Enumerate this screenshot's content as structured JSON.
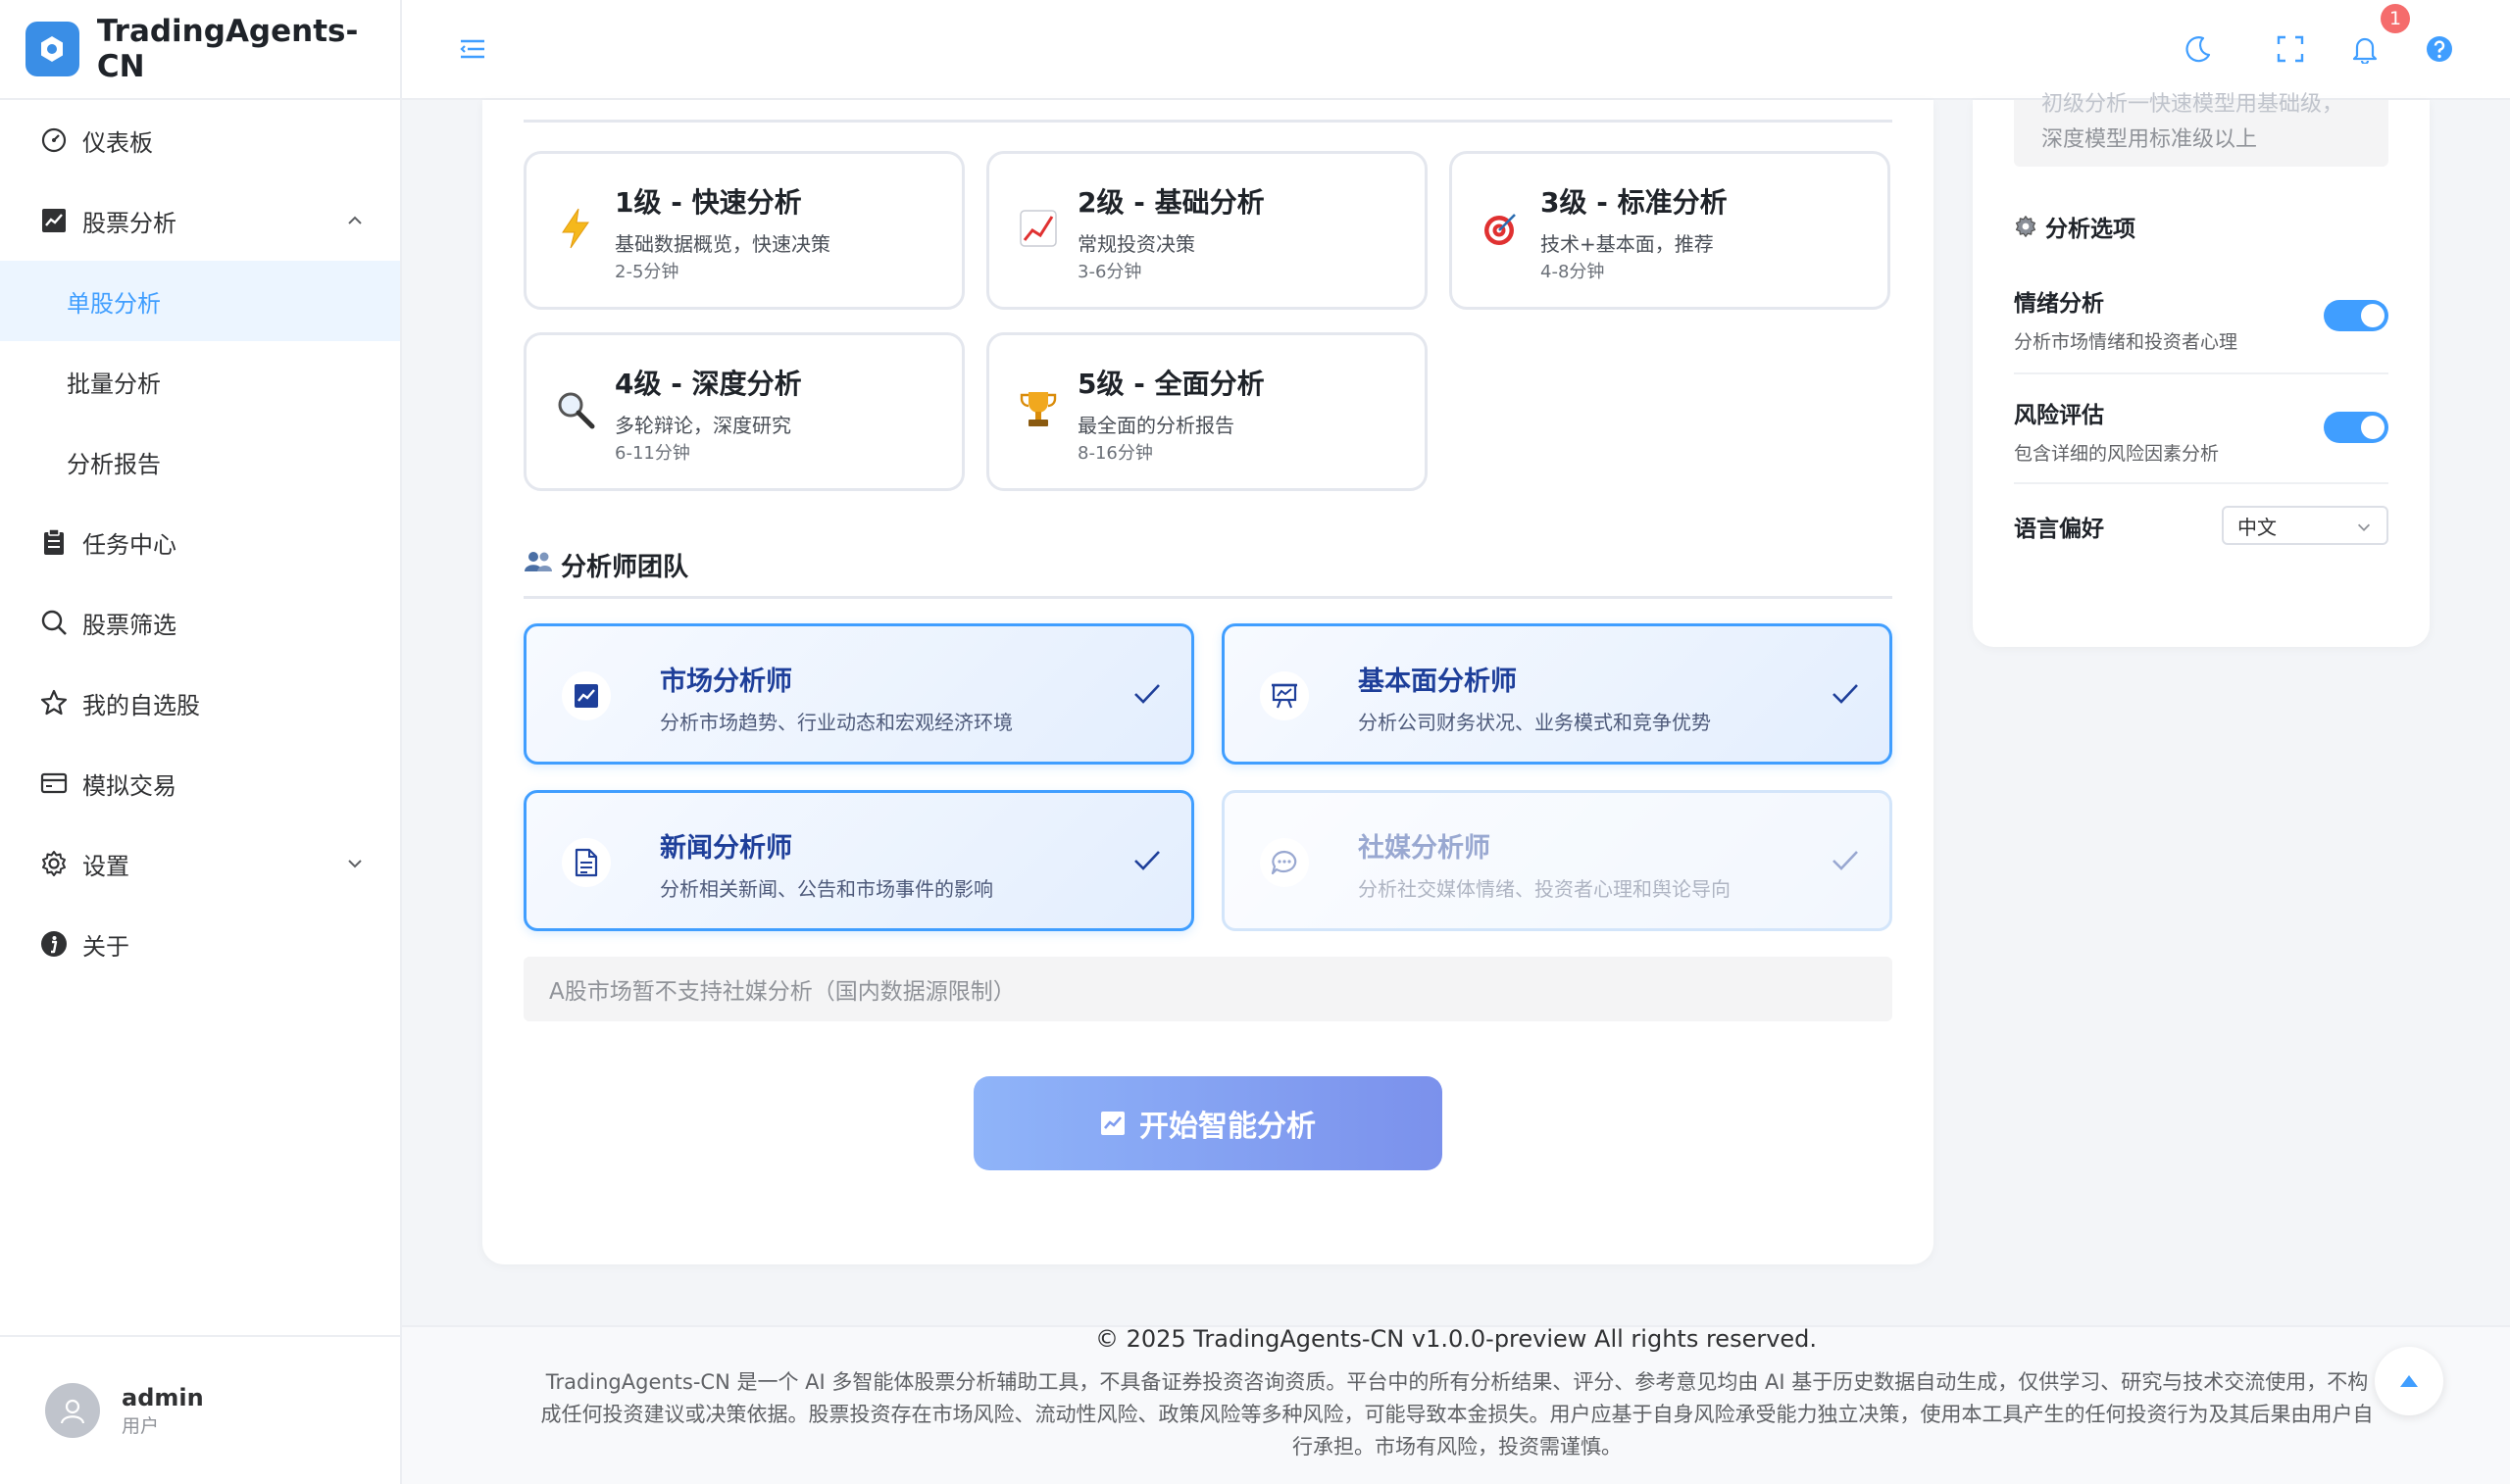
{
  "app": {
    "title": "TradingAgents-CN"
  },
  "sidebar": {
    "items": [
      {
        "label": "仪表板",
        "icon": "gauge-icon"
      },
      {
        "label": "股票分析",
        "icon": "chart-icon",
        "expanded": true,
        "children": [
          {
            "label": "单股分析",
            "active": true
          },
          {
            "label": "批量分析"
          },
          {
            "label": "分析报告"
          }
        ]
      },
      {
        "label": "任务中心",
        "icon": "clipboard-icon"
      },
      {
        "label": "股票筛选",
        "icon": "search-icon"
      },
      {
        "label": "我的自选股",
        "icon": "star-icon"
      },
      {
        "label": "模拟交易",
        "icon": "card-icon"
      },
      {
        "label": "设置",
        "icon": "gear-icon",
        "expanded": false
      },
      {
        "label": "关于",
        "icon": "info-icon"
      }
    ],
    "sub": [
      "单股分析",
      "批量分析",
      "分析报告"
    ]
  },
  "user": {
    "name": "admin",
    "role": "用户"
  },
  "header": {
    "notification_count": "1"
  },
  "levels": [
    {
      "title": "1级 - 快速分析",
      "desc": "基础数据概览，快速决策",
      "time": "2-5分钟",
      "icon": "⚡"
    },
    {
      "title": "2级 - 基础分析",
      "desc": "常规投资决策",
      "time": "3-6分钟",
      "icon": "📈"
    },
    {
      "title": "3级 - 标准分析",
      "desc": "技术+基本面，推荐",
      "time": "4-8分钟",
      "icon": "🎯"
    },
    {
      "title": "4级 - 深度分析",
      "desc": "多轮辩论，深度研究",
      "time": "6-11分钟",
      "icon": "🔍"
    },
    {
      "title": "5级 - 全面分析",
      "desc": "最全面的分析报告",
      "time": "8-16分钟",
      "icon": "🏆"
    }
  ],
  "team": {
    "title": "分析师团队",
    "analysts": [
      {
        "name": "市场分析师",
        "desc": "分析市场趋势、行业动态和宏观经济环境",
        "selected": true
      },
      {
        "name": "基本面分析师",
        "desc": "分析公司财务状况、业务模式和竞争优势",
        "selected": true
      },
      {
        "name": "新闻分析师",
        "desc": "分析相关新闻、公告和市场事件的影响",
        "selected": true
      },
      {
        "name": "社媒分析师",
        "desc": "分析社交媒体情绪、投资者心理和舆论导向",
        "selected": true,
        "disabled": true
      }
    ],
    "notice": "A股市场暂不支持社媒分析（国内数据源限制）"
  },
  "start_button": {
    "label": "开始智能分析"
  },
  "options": {
    "tip_cut": "初级分析一快速模型用基础级，",
    "tip": "深度模型用标准级以上",
    "title": "分析选项",
    "sentiment": {
      "label": "情绪分析",
      "desc": "分析市场情绪和投资者心理",
      "on": true
    },
    "risk": {
      "label": "风险评估",
      "desc": "包含详细的风险因素分析",
      "on": true
    },
    "language": {
      "label": "语言偏好",
      "value": "中文"
    }
  },
  "footer": {
    "copyright": "© 2025 TradingAgents-CN v1.0.0-preview All rights reserved.",
    "disclaimer": "TradingAgents-CN 是一个 AI 多智能体股票分析辅助工具，不具备证券投资咨询资质。平台中的所有分析结果、评分、参考意见均由 AI 基于历史数据自动生成，仅供学习、研究与技术交流使用，不构成任何投资建议或决策依据。股票投资存在市场风险、流动性风险、政策风险等多种风险，可能导致本金损失。用户应基于自身风险承受能力独立决策，使用本工具产生的任何投资行为及其后果由用户自行承担。市场有风险，投资需谨慎。"
  },
  "colors": {
    "primary": "#409eff",
    "active_bg": "#ecf5ff",
    "badge": "#f56c6c"
  }
}
